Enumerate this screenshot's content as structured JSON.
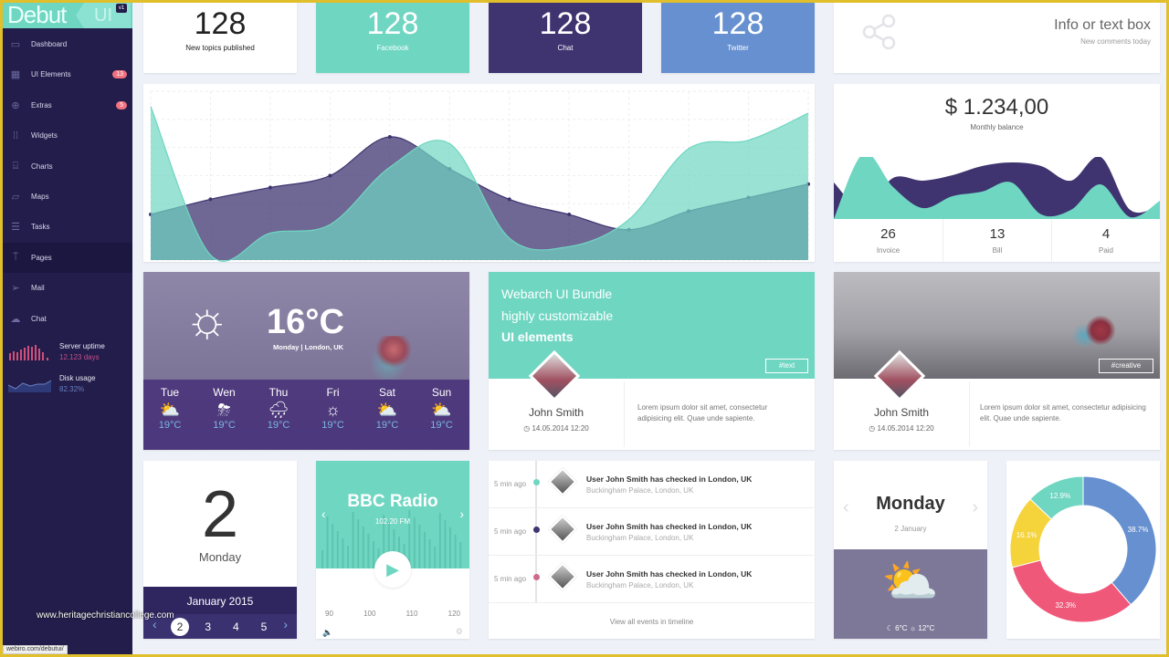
{
  "sidebar": {
    "logo": "Debut",
    "logo_ui": "UI",
    "version": "v1",
    "items": [
      {
        "label": "Dashboard",
        "icon": "monitor-icon"
      },
      {
        "label": "UI Elements",
        "icon": "layout-icon",
        "badge": "13"
      },
      {
        "label": "Extras",
        "icon": "globe-icon",
        "badge": "5"
      },
      {
        "label": "Widgets",
        "icon": "grid-icon"
      },
      {
        "label": "Charts",
        "icon": "presentation-icon"
      },
      {
        "label": "Maps",
        "icon": "map-icon"
      },
      {
        "label": "Tasks",
        "icon": "tasks-icon"
      },
      {
        "label": "Pages",
        "icon": "signpost-icon",
        "active": true
      },
      {
        "label": "Mail",
        "icon": "paper-plane-icon"
      },
      {
        "label": "Chat",
        "icon": "chat-icon"
      }
    ],
    "server_uptime": {
      "label": "Server uptime",
      "value": "12.123 days"
    },
    "disk_usage": {
      "label": "Disk usage",
      "value": "82.32%"
    }
  },
  "tiles": [
    {
      "value": "128",
      "label": "New topics published",
      "color": "#ffffff"
    },
    {
      "value": "128",
      "label": "Facebook",
      "color": "#6fd6c2"
    },
    {
      "value": "128",
      "label": "Chat",
      "color": "#3f3470"
    },
    {
      "value": "128",
      "label": "Twitter",
      "color": "#6690d0"
    }
  ],
  "info_box": {
    "title": "Info or text box",
    "subtitle": "New comments today",
    "icon": "share-icon"
  },
  "chart_data": [
    {
      "type": "area",
      "series": [
        {
          "color": "#3f3470",
          "values": [
            27,
            36,
            43,
            50,
            73,
            54,
            36,
            27,
            18,
            29,
            37,
            45
          ]
        },
        {
          "color": "#6fd6c2",
          "values": [
            91,
            3,
            16,
            21,
            55,
            69,
            13,
            8,
            24,
            66,
            71,
            87
          ]
        }
      ],
      "ylim": [
        0,
        100
      ],
      "grid": true
    },
    {
      "type": "pie",
      "values": [
        38.7,
        32.3,
        16.1,
        12.9
      ],
      "labels": [
        "38.7%",
        "32.3%",
        "16.1%",
        "12.9%"
      ],
      "colors": [
        "#6690d0",
        "#f0587a",
        "#f5d33b",
        "#6fd6c2"
      ]
    }
  ],
  "balance": {
    "amount": "$ 1.234,00",
    "label": "Monthly balance",
    "series": [
      {
        "color": "#3f3470",
        "values": [
          40,
          10,
          45,
          42,
          48,
          58,
          62,
          58,
          42,
          68,
          10,
          15
        ]
      },
      {
        "color": "#6fd6c2",
        "values": [
          0,
          72,
          35,
          12,
          25,
          30,
          40,
          5,
          10,
          38,
          2,
          20
        ]
      }
    ],
    "stats": [
      {
        "value": "26",
        "label": "Invoice"
      },
      {
        "value": "13",
        "label": "Bill"
      },
      {
        "value": "4",
        "label": "Paid"
      }
    ]
  },
  "weather": {
    "temp": "16°C",
    "place": "Monday | London, UK",
    "forecast": [
      {
        "day": "Tue",
        "icon": "cloud-sun-icon",
        "glyph": "⛅",
        "temp": "19°C"
      },
      {
        "day": "Wen",
        "icon": "thunder-icon",
        "glyph": "⛈",
        "temp": "19°C"
      },
      {
        "day": "Thu",
        "icon": "rain-icon",
        "glyph": "🌧",
        "temp": "19°C"
      },
      {
        "day": "Fri",
        "icon": "sun-icon",
        "glyph": "☼",
        "temp": "19°C"
      },
      {
        "day": "Sat",
        "icon": "sun-cloud-icon",
        "glyph": "⛅",
        "temp": "19°C"
      },
      {
        "day": "Sun",
        "icon": "sun-cloud-icon",
        "glyph": "⛅",
        "temp": "19°C"
      }
    ]
  },
  "promo": {
    "line1a": "Webarch ",
    "line1b": "UI Bundle",
    "line2": "highly customizable",
    "line3": "UI elements",
    "button": "#text",
    "name": "John Smith",
    "date": "14.05.2014 12:20",
    "text": "Lorem ipsum dolor sit amet, consectetur adipisicing elit. Quae unde sapiente."
  },
  "photo_card": {
    "button": "#creative",
    "name": "John Smith",
    "date": "14.05.2014 12:20",
    "text": "Lorem ipsum dolor sit amet, consectetur adipisicing elit. Quae unde sapiente."
  },
  "date_card": {
    "day": "2",
    "weekday": "Monday",
    "month": "January 2015",
    "days": [
      "2",
      "3",
      "4",
      "5"
    ]
  },
  "radio": {
    "title": "BBC Radio",
    "freq": "102.20 FM",
    "scale": [
      "90",
      "100",
      "110",
      "120"
    ]
  },
  "timeline": {
    "items": [
      {
        "ago": "5 min ago",
        "title": "User John Smith has checked in London, UK",
        "sub": "Buckingham Palace, London, UK",
        "color": "#6fd6c2"
      },
      {
        "ago": "5 min ago",
        "title": "User John Smith has checked in London, UK",
        "sub": "Buckingham Palace, London, UK",
        "color": "#3f3470"
      },
      {
        "ago": "5 min ago",
        "title": "User John Smith has checked in London, UK",
        "sub": "Buckingham Palace, London, UK",
        "color": "#d06a8a"
      }
    ],
    "footer": "View all events in timeline"
  },
  "day_weather": {
    "day": "Monday",
    "date": "2 January",
    "low": "6°C",
    "high": "12°C"
  },
  "watermark": "www.heritagechristiancollege.com",
  "status_url": "webiro.com/debutui/"
}
